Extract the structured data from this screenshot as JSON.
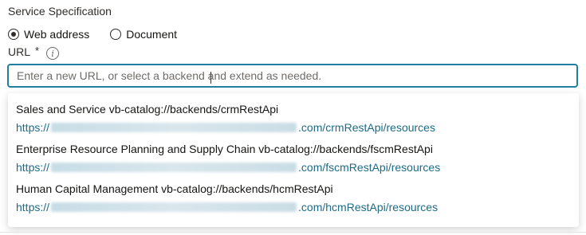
{
  "section_title": "Service Specification",
  "radio_options": [
    {
      "label": "Web address",
      "selected": true
    },
    {
      "label": "Document",
      "selected": false
    }
  ],
  "url_field": {
    "label": "URL",
    "required_marker": "*",
    "placeholder": "Enter a new URL, or select a backend and extend as needed.",
    "value": ""
  },
  "icons": {
    "info": "info-icon"
  },
  "colors": {
    "input_border": "#227e9e",
    "link": "#1d6b86"
  },
  "suggestions": [
    {
      "title": "Sales and Service vb-catalog://backends/crmRestApi",
      "url_prefix": "https://",
      "url_suffix": ".com/crmRestApi/resources"
    },
    {
      "title": "Enterprise Resource Planning and Supply Chain vb-catalog://backends/fscmRestApi",
      "url_prefix": "https://",
      "url_suffix": ".com/fscmRestApi/resources"
    },
    {
      "title": "Human Capital Management vb-catalog://backends/hcmRestApi",
      "url_prefix": "https://",
      "url_suffix": ".com/hcmRestApi/resources"
    }
  ]
}
